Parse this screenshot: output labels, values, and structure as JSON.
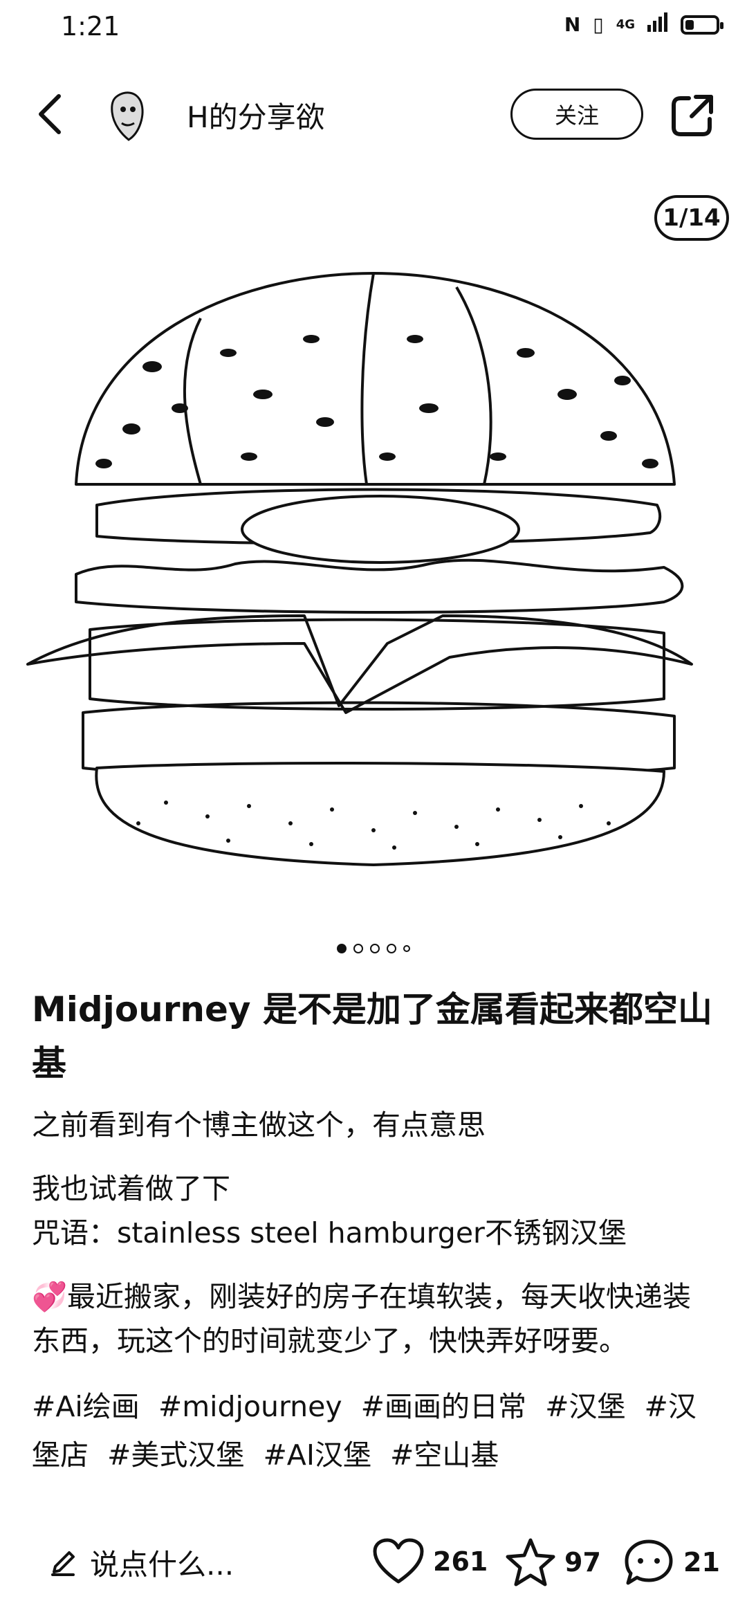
{
  "status_bar": {
    "time": "1:21",
    "network": "4G"
  },
  "header": {
    "back_icon": "chevron-left-icon",
    "username": "H的分享欲",
    "follow_label": "关注",
    "share_icon": "share-icon"
  },
  "gallery": {
    "counter": "1/14",
    "image_description_icon": "hamburger-image",
    "dots_total": 5,
    "dots_active": 0
  },
  "post": {
    "title": "Midjourney 是不是加了金属看起来都空山基",
    "para1": "之前看到有个博主做这个，有点意思",
    "para2_line1": "我也试着做了下",
    "para2_line2": "咒语：stainless steel hamburger不锈钢汉堡",
    "para3": "💞最近搬家，刚装好的房子在填软装，每天收快递装东西，玩这个的时间就变少了，快快弄好呀要。",
    "tags": [
      "#Ai绘画",
      "#midjourney",
      "#画画的日常",
      "#汉堡",
      "#汉堡店",
      "#美式汉堡",
      "#AI汉堡",
      "#空山基"
    ]
  },
  "bottom_bar": {
    "comment_placeholder": "说点什么...",
    "likes": "261",
    "favorites": "97",
    "comments": "21"
  }
}
